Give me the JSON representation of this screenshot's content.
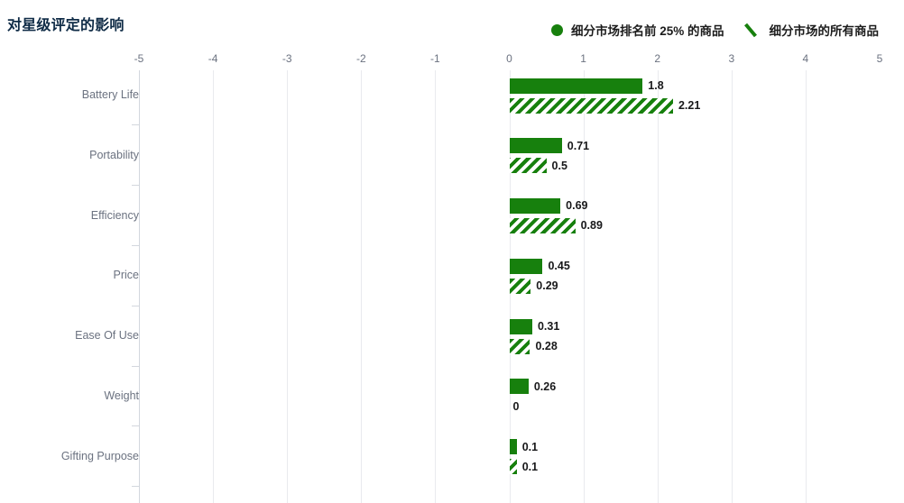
{
  "title": "对星级评定的影响",
  "legend": [
    {
      "label": "细分市场排名前 25% 的商品",
      "marker": "circle-icon",
      "color": "#17800d"
    },
    {
      "label": "细分市场的所有商品",
      "marker": "hatch-stroke-icon",
      "color": "#17800d"
    }
  ],
  "colors": {
    "bar": "#17800d",
    "title": "#0f2b46",
    "tick": "#6b7280",
    "gridline": "#e9eaee",
    "axis": "#d3d7de",
    "value": "#18181a"
  },
  "chart_data": {
    "type": "bar",
    "orientation": "horizontal",
    "title": "对星级评定的影响",
    "xlabel": "",
    "ylabel": "",
    "xlim": [
      -5,
      5
    ],
    "xticks": [
      -5,
      -4,
      -3,
      -2,
      -1,
      0,
      1,
      2,
      3,
      4,
      5
    ],
    "xtick_labels": [
      "-5",
      "-4",
      "-3",
      "-2",
      "-1",
      "0",
      "1",
      "2",
      "3",
      "4",
      "5"
    ],
    "grid": true,
    "legend_position": "top-right",
    "categories": [
      "Battery Life",
      "Portability",
      "Efficiency",
      "Price",
      "Ease Of Use",
      "Weight",
      "Gifting Purpose"
    ],
    "series": [
      {
        "name": "细分市场排名前 25% 的商品",
        "style": "solid",
        "color": "#17800d",
        "values": [
          1.8,
          0.71,
          0.69,
          0.45,
          0.31,
          0.26,
          0.1
        ],
        "labels": [
          "1.8",
          "0.71",
          "0.69",
          "0.45",
          "0.31",
          "0.26",
          "0.1"
        ]
      },
      {
        "name": "细分市场的所有商品",
        "style": "hatched",
        "color": "#17800d",
        "values": [
          2.21,
          0.5,
          0.89,
          0.29,
          0.28,
          0,
          0.1
        ],
        "labels": [
          "2.21",
          "0.5",
          "0.89",
          "0.29",
          "0.28",
          "0",
          "0.1"
        ]
      }
    ]
  }
}
